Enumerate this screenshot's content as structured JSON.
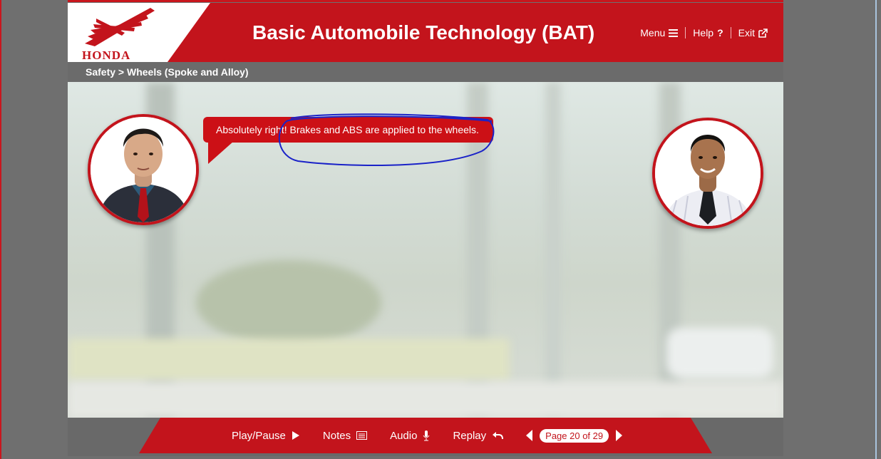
{
  "header": {
    "brand": "HONDA",
    "title": "Basic Automobile Technology (BAT)",
    "menu_label": "Menu",
    "help_label": "Help",
    "exit_label": "Exit"
  },
  "breadcrumb": "Safety > Wheels (Spoke and Alloy)",
  "dialog": {
    "speech": "Absolutely right! Brakes and ABS are applied to the wheels."
  },
  "footer": {
    "play_label": "Play/Pause",
    "notes_label": "Notes",
    "audio_label": "Audio",
    "replay_label": "Replay",
    "page_indicator": "Page 20 of 29"
  },
  "icons": [
    "honda-wing-logo",
    "menu-icon",
    "help-icon",
    "exit-icon",
    "play-icon",
    "notes-icon",
    "microphone-icon",
    "replay-icon",
    "prev-arrow-icon",
    "next-arrow-icon"
  ],
  "colors": {
    "brand_red": "#c3141c",
    "bar_gray": "#6b6b6b",
    "annotation_blue": "#1a22c8"
  }
}
